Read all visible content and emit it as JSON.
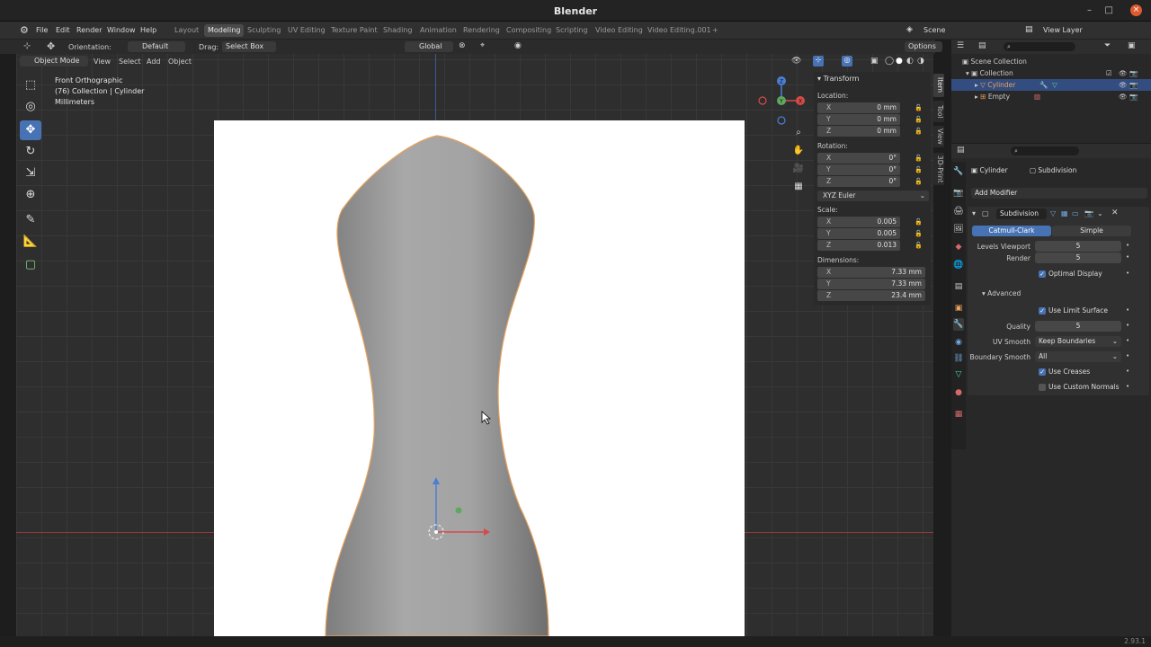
{
  "window": {
    "title": "Blender",
    "minimize": "–",
    "maximize": "□",
    "close": "×"
  },
  "menubar": {
    "menus": [
      "File",
      "Edit",
      "Render",
      "Window",
      "Help"
    ],
    "workspaces": [
      "Layout",
      "Modeling",
      "Sculpting",
      "UV Editing",
      "Texture Paint",
      "Shading",
      "Animation",
      "Rendering",
      "Compositing",
      "Scripting",
      "Video Editing",
      "Video Editing.001"
    ],
    "active_workspace": "Modeling",
    "add_workspace": "+",
    "scene_label": "Scene",
    "view_layer_label": "View Layer"
  },
  "tool_header": {
    "orientation_label": "Orientation:",
    "orientation_value": "Default",
    "drag_label": "Drag:",
    "drag_value": "Select Box",
    "transform_orientation": "Global",
    "options": "Options"
  },
  "viewport_header": {
    "mode": "Object Mode",
    "menus": [
      "View",
      "Select",
      "Add",
      "Object"
    ]
  },
  "viewport_info": {
    "line1": "Front Orthographic",
    "line2": "(76) Collection | Cylinder",
    "line3": "Millimeters"
  },
  "gizmo": {
    "z": "Z",
    "x": "X",
    "y": "Y"
  },
  "sidebar_tabs": [
    "Item",
    "Tool",
    "View",
    "3D-Print"
  ],
  "npanel": {
    "header": "Transform",
    "location_label": "Location:",
    "location": [
      {
        "axis": "X",
        "value": "0 mm"
      },
      {
        "axis": "Y",
        "value": "0 mm"
      },
      {
        "axis": "Z",
        "value": "0 mm"
      }
    ],
    "rotation_label": "Rotation:",
    "rotation": [
      {
        "axis": "X",
        "value": "0°"
      },
      {
        "axis": "Y",
        "value": "0°"
      },
      {
        "axis": "Z",
        "value": "0°"
      }
    ],
    "rotation_mode": "XYZ Euler",
    "scale_label": "Scale:",
    "scale": [
      {
        "axis": "X",
        "value": "0.005"
      },
      {
        "axis": "Y",
        "value": "0.005"
      },
      {
        "axis": "Z",
        "value": "0.013"
      }
    ],
    "dimensions_label": "Dimensions:",
    "dimensions": [
      {
        "axis": "X",
        "value": "7.33 mm"
      },
      {
        "axis": "Y",
        "value": "7.33 mm"
      },
      {
        "axis": "Z",
        "value": "23.4 mm"
      }
    ]
  },
  "outliner": {
    "rows": [
      {
        "label": "Scene Collection"
      },
      {
        "label": "Collection"
      },
      {
        "label": "Cylinder"
      },
      {
        "label": "Empty"
      }
    ]
  },
  "properties": {
    "object_name": "Cylinder",
    "modifier_name": "Subdivision",
    "add_modifier": "Add Modifier",
    "mod_title": "Subdivision",
    "catmull": "Catmull-Clark",
    "simple": "Simple",
    "levels_viewport_label": "Levels Viewport",
    "levels_viewport": "5",
    "render_label": "Render",
    "render": "5",
    "optimal_display": "Optimal Display",
    "advanced": "Advanced",
    "use_limit_surface": "Use Limit Surface",
    "quality_label": "Quality",
    "quality": "5",
    "uv_smooth_label": "UV Smooth",
    "uv_smooth": "Keep Boundaries",
    "boundary_smooth_label": "Boundary Smooth",
    "boundary_smooth": "All",
    "use_creases": "Use Creases",
    "use_custom_normals": "Use Custom Normals"
  },
  "statusbar": {
    "version": "2.93.1"
  },
  "colors": {
    "accent": "#4772b3",
    "selected_row": "#334d80",
    "active_object_outline": "#e8a25a"
  }
}
